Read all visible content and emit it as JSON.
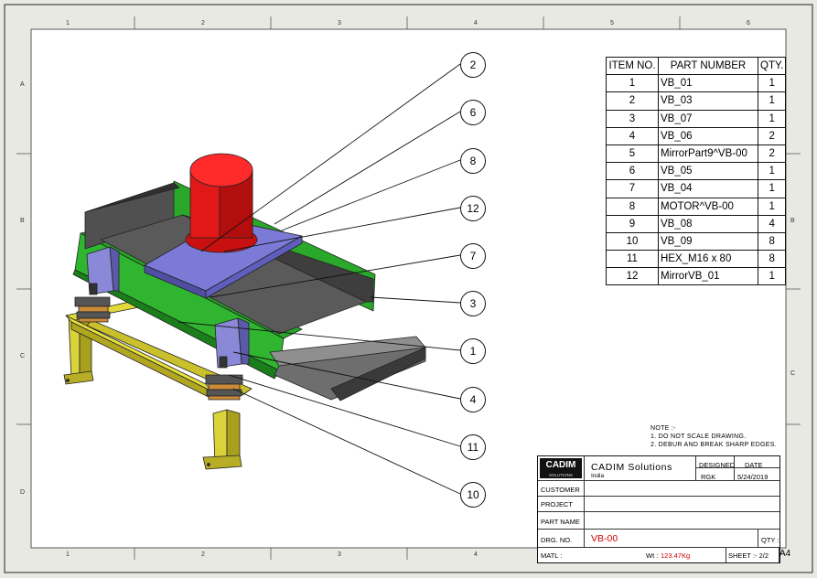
{
  "zones": {
    "top": [
      "1",
      "2",
      "3",
      "4",
      "5",
      "6"
    ],
    "bottom": [
      "1",
      "2",
      "3",
      "4"
    ],
    "left": [
      "A",
      "B",
      "C",
      "D"
    ],
    "right": [
      "B",
      "C"
    ]
  },
  "balloons": [
    "2",
    "6",
    "8",
    "12",
    "7",
    "3",
    "1",
    "4",
    "11",
    "10"
  ],
  "bom": {
    "headers": [
      "ITEM NO.",
      "PART NUMBER",
      "QTY."
    ],
    "rows": [
      [
        "1",
        "VB_01",
        "1"
      ],
      [
        "2",
        "VB_03",
        "1"
      ],
      [
        "3",
        "VB_07",
        "1"
      ],
      [
        "4",
        "VB_06",
        "2"
      ],
      [
        "5",
        "MirrorPart9^VB-00",
        "2"
      ],
      [
        "6",
        "VB_05",
        "1"
      ],
      [
        "7",
        "VB_04",
        "1"
      ],
      [
        "8",
        "MOTOR^VB-00",
        "1"
      ],
      [
        "9",
        "VB_08",
        "4"
      ],
      [
        "10",
        "VB_09",
        "8"
      ],
      [
        "11",
        "HEX_M16 x 80",
        "8"
      ],
      [
        "12",
        "MirrorVB_01",
        "1"
      ]
    ]
  },
  "notes": {
    "title": "NOTE :-",
    "line1": "1. DO NOT SCALE DRAWING.",
    "line2": "2. DEBUR AND BREAK SHARP EDGES."
  },
  "title_block": {
    "logo_text": "CADIM",
    "logo_sub": "SOLUTIONS",
    "company": "CADIM  Solutions",
    "location": "India",
    "designed_label": "DESIGNED",
    "date_label": "DATE",
    "designer": "RGK",
    "date": "5/24/2019",
    "customer_label": "CUSTOMER",
    "project_label": "PROJECT",
    "part_name_label": "PART NAME",
    "drg_no_label": "DRG. NO.",
    "drg_no": "VB-00",
    "qty_label": "QTY :",
    "matl_label": "MATL :",
    "wt_label": "Wt :",
    "wt_value": "123.47Kg",
    "sheet": "SHEET :- 2/2",
    "size": "A4"
  }
}
